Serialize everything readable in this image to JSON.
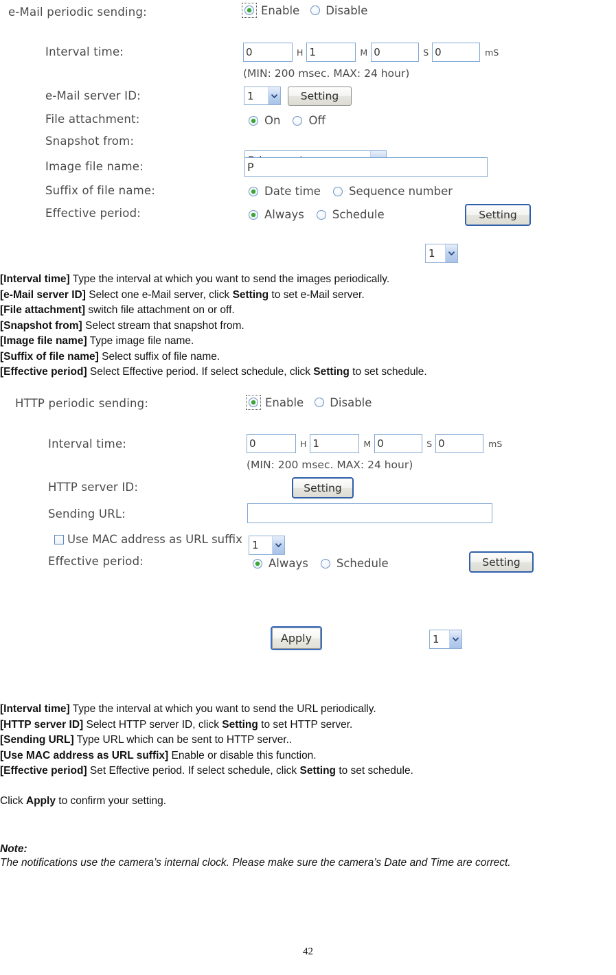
{
  "email_section": {
    "title_label": "e-Mail periodic sending:",
    "enable_label": "Enable",
    "disable_label": "Disable",
    "enabled_selected": "Enable",
    "interval_label": "Interval time:",
    "interval": {
      "hours": "0",
      "hours_unit": "H",
      "minutes": "1",
      "minutes_unit": "M",
      "seconds": "0",
      "seconds_unit": "S",
      "millis": "0",
      "millis_unit": "mS",
      "hint": "(MIN: 200 msec. MAX: 24 hour)"
    },
    "server_id_label": "e-Mail server ID:",
    "server_id_value": "1",
    "server_id_setting_button": "Setting",
    "file_attachment_label": "File attachment:",
    "file_attachment_on": "On",
    "file_attachment_off": "Off",
    "file_attachment_selected": "On",
    "snapshot_from_label": "Snapshot from:",
    "snapshot_from_value": "Primary stream",
    "image_file_name_label": "Image file name:",
    "image_file_name_value": "P",
    "suffix_label": "Suffix of file name:",
    "suffix_date_time": "Date time",
    "suffix_sequence_number": "Sequence number",
    "suffix_selected": "Date time",
    "effective_period_label": "Effective period:",
    "effective_always": "Always",
    "effective_schedule": "Schedule",
    "effective_selected": "Always",
    "effective_schedule_id": "1",
    "effective_setting_button": "Setting"
  },
  "email_help": [
    {
      "term": "[Interval time]",
      "rest": " Type the interval at which you want to send the images periodically."
    },
    {
      "term": "[e-Mail server ID]",
      "rest": " Select one e-Mail server, click ",
      "bold": "Setting",
      "tail": " to set e-Mail server."
    },
    {
      "term": "[File attachment]",
      "rest": " switch file attachment on or off."
    },
    {
      "term": "[Snapshot from]",
      "rest": " Select stream that snapshot from."
    },
    {
      "term": "[Image file name]",
      "rest": " Type image file name."
    },
    {
      "term": "[Suffix of file name]",
      "rest": " Select suffix of file name."
    },
    {
      "term": "[Effective period]",
      "rest": " Select Effective period. If select schedule, click ",
      "bold": "Setting",
      "tail": " to set schedule."
    }
  ],
  "http_section": {
    "title_label": "HTTP periodic sending:",
    "enable_label": "Enable",
    "disable_label": "Disable",
    "enabled_selected": "Enable",
    "interval_label": "Interval time:",
    "interval": {
      "hours": "0",
      "hours_unit": "H",
      "minutes": "1",
      "minutes_unit": "M",
      "seconds": "0",
      "seconds_unit": "S",
      "millis": "0",
      "millis_unit": "mS",
      "hint": "(MIN: 200 msec. MAX: 24 hour)"
    },
    "server_id_label": "HTTP server ID:",
    "server_id_value": "1",
    "server_id_setting_button": "Setting",
    "sending_url_label": "Sending URL:",
    "sending_url_value": "",
    "mac_suffix_label": "Use MAC address as URL suffix",
    "mac_suffix_checked": false,
    "effective_period_label": "Effective period:",
    "effective_always": "Always",
    "effective_schedule": "Schedule",
    "effective_selected": "Always",
    "effective_schedule_id": "1",
    "effective_setting_button": "Setting"
  },
  "apply_button": "Apply",
  "http_help": [
    {
      "term": "[Interval time]",
      "rest": " Type the interval at which you want to send the URL periodically."
    },
    {
      "term": "[HTTP server ID]",
      "rest": " Select HTTP server ID, click ",
      "bold": "Setting",
      "tail": " to set HTTP server."
    },
    {
      "term": "[Sending URL]",
      "rest": " Type URL which can be sent to HTTP server.."
    },
    {
      "term": "[Use MAC address as URL suffix]",
      "rest": " Enable or disable this function."
    },
    {
      "term": "[Effective period]",
      "rest": " Set Effective period. If select schedule, click ",
      "bold": "Setting",
      "tail": " to set schedule."
    }
  ],
  "apply_hint": {
    "pre": "Click ",
    "bold": "Apply",
    "post": " to confirm your setting."
  },
  "note": {
    "title": "Note:",
    "body": "The notifications use the camera’s internal clock. Please make sure the camera’s Date and Time are correct."
  },
  "page_number": "42",
  "colors": {
    "input_border": "#7fa7d4",
    "radio_dot": "#36a832",
    "focus_ring": "#3b6fc0",
    "text": "#4a4a4a"
  }
}
